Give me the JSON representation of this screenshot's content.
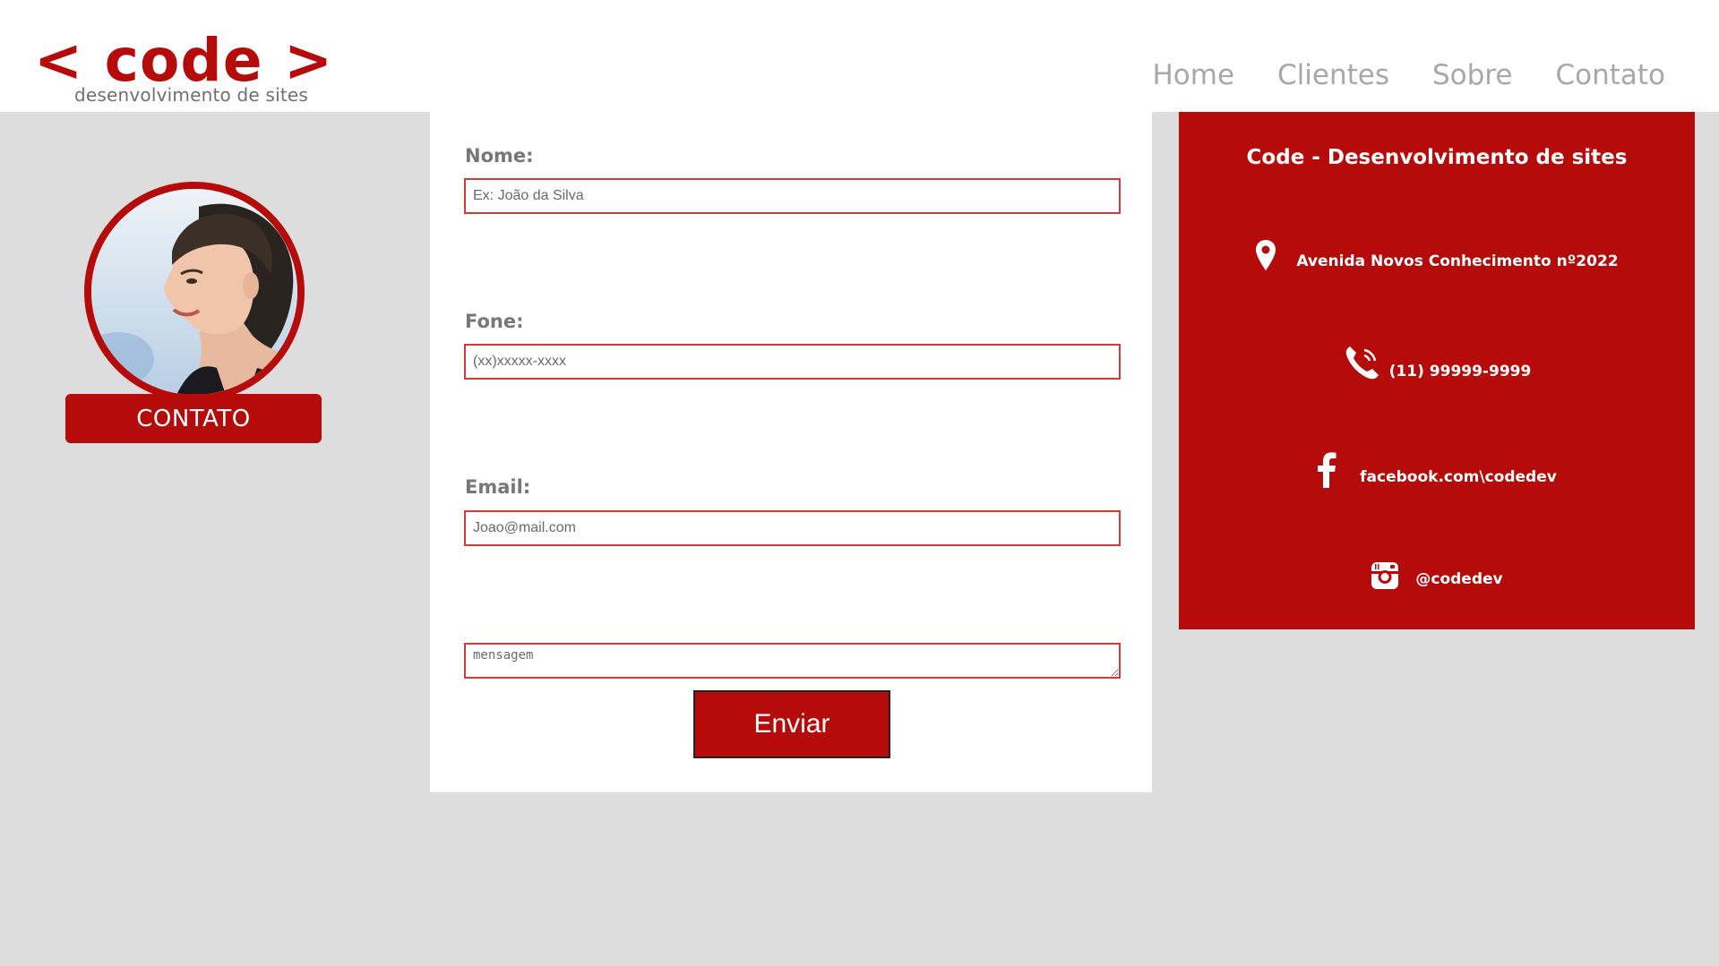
{
  "brand": {
    "logo": "< code >",
    "tagline": "desenvolvimento de sites"
  },
  "nav": {
    "items": [
      {
        "label": "Home"
      },
      {
        "label": "Clientes"
      },
      {
        "label": "Sobre"
      },
      {
        "label": "Contato"
      }
    ]
  },
  "profile": {
    "button_label": "CONTATO"
  },
  "form": {
    "name_label": "Nome:",
    "name_placeholder": "Ex: João da Silva",
    "phone_label": "Fone:",
    "phone_placeholder": "(xx)xxxxx-xxxx",
    "email_label": "Email:",
    "email_placeholder": "Joao@mail.com",
    "message_placeholder": "mensagem",
    "submit_label": "Enviar"
  },
  "info": {
    "title": "Code - Desenvolvimento de sites",
    "address": "Avenida Novos Conhecimento nº2022",
    "phone": "(11) 99999-9999",
    "facebook": "facebook.com\\codedev",
    "instagram": "@codedev"
  },
  "colors": {
    "brand_red": "#b50b0b",
    "background": "#dddddd",
    "nav_text": "#a8a8a8"
  },
  "icons": [
    "map-pin-icon",
    "phone-icon",
    "facebook-icon",
    "instagram-icon"
  ]
}
